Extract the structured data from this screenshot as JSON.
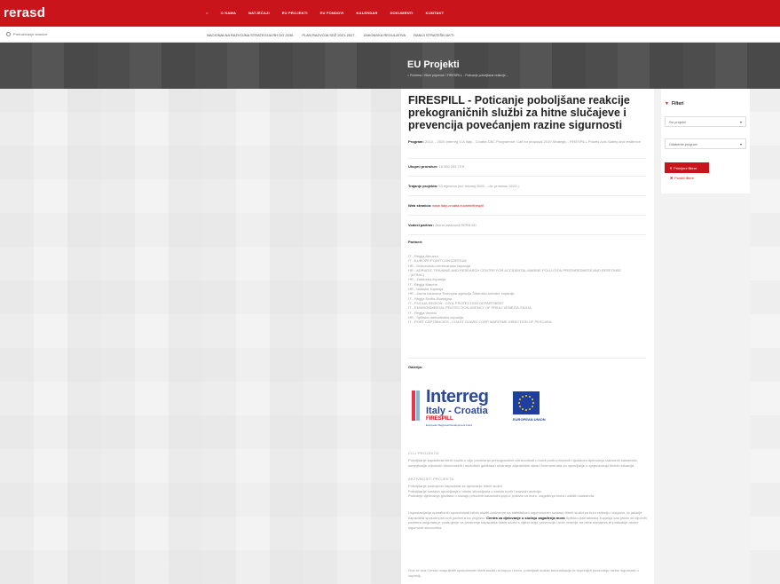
{
  "brand": {
    "logo": "rerasd",
    "accent": "#c8141a"
  },
  "nav": {
    "items": [
      "O NAMA",
      "NATJEČAJI",
      "EU PROJEKTI",
      "EU FONDOVI",
      "KALENDAR",
      "DOKUMENTI",
      "KONTAKT"
    ]
  },
  "search": {
    "placeholder": "Pretraživanje stranice"
  },
  "subnav": {
    "items": [
      "NACIONALNA RAZVOJNA STRATEGIJA RH DO 2030.",
      "PLAN RAZVOJA SDŽ 2021-2027.",
      "ZAKONSKA REGULATIVA",
      "RANIJI STRATEŠKI AKTI"
    ]
  },
  "hero": {
    "title": "EU Projekti",
    "breadcrumb": "⌂ Početna  /  Hitne pripreme  /  FIRESPILL - Poticanje poboljšane reakcije..."
  },
  "project": {
    "title": "FIRESPILL - Poticanje poboljšane reakcije prekograničnih službi za hitne slučajeve i prevencija povećanjem razine sigurnosti",
    "program_label": "Program:",
    "program_value": "2014. - 2020 Interreg V-A Italy - Croatia CBC Programme; Call for proposal 2019 Strategic - FIRESPILL Priority Axis Safety and resilience",
    "budget_label": "Ukupni proračun:",
    "budget_value": "16.950.299,70 €",
    "duration_label": "Trajanje projekta:",
    "duration_value": "33 mjeseca (od: travanj 2020. - do: prosinac 2022.)",
    "web_label": "Web stranica:",
    "web_value": "www.italy-croatia.eu/web/firespill",
    "lead_label": "Vodeći partner:",
    "lead_value": "Javna ustanova RERA SD",
    "partners_label": "Partneri:",
    "partners": [
      "IT - Regija Abruzzo",
      "IT - EUROPE POINT CONSORTIUM",
      "HR - Dubrovačko-neretvanska županija",
      "HR - ADRIATIC TRAINING AND RESEARCH CENTRE FOR ACCIDENTAL MARINE POLLUTION PREPAREDNESS AND RESPONSE",
      "- (ATRAC)",
      "HR - Zadarska županija",
      "IT - Regija Marche",
      "HR - Istarska županija",
      "HR - Javna ustanova Razvojna agencija Šibensko-kninske županije",
      "IT - Regija Emilia-Romagna",
      "IT - PUGLIA REGION - CIVIL PROTECTION DEPARTMENT",
      "IT - ENVIRONMENTAL PROTECTION AGENCY OF FRIULI VENEZIA GIULIA",
      "IT - Regija Veneto",
      "HR - Splitsko-dalmatinska županija",
      "IT - PORT CAPTAINCIES - COAST GUARD CORP MARITIME DIRECTION OF PESCARA"
    ],
    "gallery_label": "Galerija:",
    "interreg_word": "Interreg",
    "interreg_sub": "Italy - Croatia",
    "interreg_project": "FIRESPILL",
    "interreg_fund": "European Regional Development Fund",
    "eu_label": "EUROPEAN UNION",
    "goals_title": "CILJ PROJEKTA:",
    "goals_text": "Poboljšanje kapaciteta hitnih službi u cilju povećanja prekogranične učinkovitosti u borbi protiv prirodnih i ljudskom djelovanju izazvanih katastrofa, smanjivanje odnosnih ekonomskih i ekoloških gubitaka i stvaranje zajedničkih alata i instrumenata za upravljanje u sprječavanju kriznih situacija.",
    "activities_title": "AKTIVNOSTI PROJEKTA:",
    "activities_lines": [
      "Poboljšanje postojećih kapaciteta za djelovanje hitnih službi.",
      "Poboljšanje sustava upravljanja u hitnim situacijama u smislu brzih i izravnih reakcija.",
      "Poticanje djelovanja građana u slučaju prirodnih katastrofa poput: požara na moru, zagađenja mora i ostalih katastrofa."
    ],
    "center_text_a": "Uspostavljanje operativnih sposobnosti hitnih službi nadzorom na satelitskom sigurnosnom sustavu hitnih službi za brzu reakciju i odgovor, te jačanje kapaciteta sposobnosti svih partnera na projektu.",
    "center_bold": "Centra za djelovanje u slučaju zagađenja mora",
    "center_text_b": "Splitsko-dalmatinska županija kao jedan od ključnih partnera osigurala je postrojenje za proširenje kapaciteta hitnih službi s ciljem bolje prevencije i brže reakcije na hitne slučajeve te podizanje razine sigurnosti stanovnika.",
    "closing_text": "Ova će dva Centra unaprijediti sposobnosti hitnih službi na kopnu i moru, poboljšati sustav komunikacije te doprinijeti povećanju razine sigurnosti u županiji."
  },
  "sidebar": {
    "title": "Filteri",
    "select_1": "Svi projekti",
    "select_2": "Odaberite program",
    "apply_label": "Primijeni filtere",
    "reset_label": "Poništi filtere"
  }
}
